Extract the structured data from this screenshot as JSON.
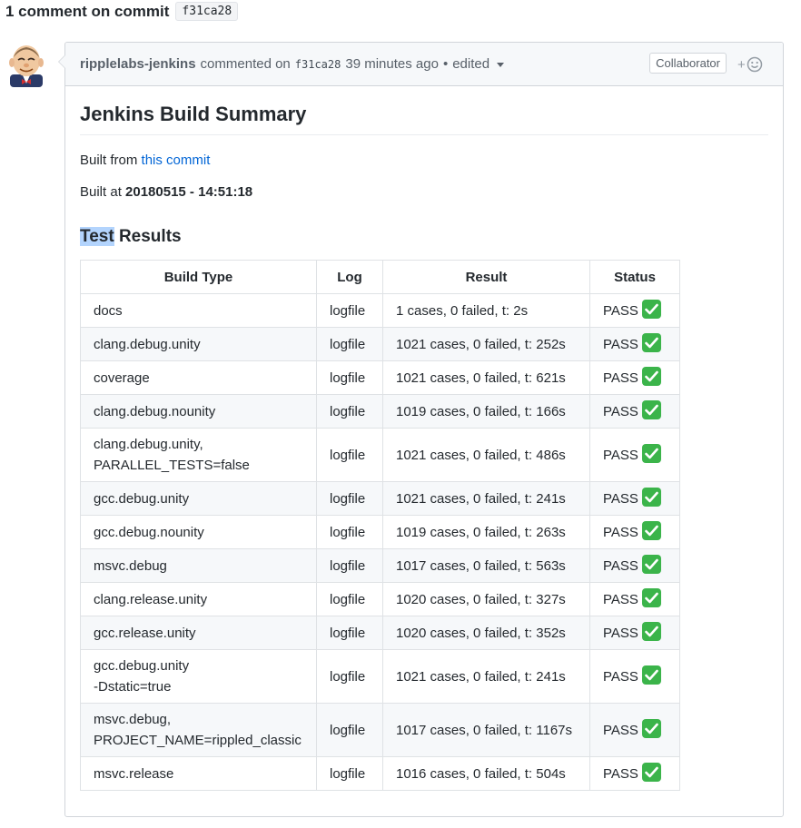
{
  "heading": {
    "text": "1 comment on commit",
    "sha": "f31ca28"
  },
  "comment": {
    "author": "ripplelabs-jenkins",
    "commented_on": "commented on",
    "sha": "f31ca28",
    "time": "39 minutes ago",
    "bullet": "•",
    "edited": "edited",
    "badge": "Collaborator",
    "reaction_plus": "+"
  },
  "body": {
    "title": "Jenkins Build Summary",
    "built_from_prefix": "Built from",
    "built_from_link": "this commit",
    "built_at_prefix": "Built at",
    "built_at_value": "20180515 - 14:51:18",
    "results_title_highlight": "Test",
    "results_title_rest": "Results"
  },
  "table": {
    "headers": [
      "Build Type",
      "Log",
      "Result",
      "Status"
    ],
    "rows": [
      {
        "type": "docs",
        "type2": "",
        "log": "logfile",
        "result": "1 cases, 0 failed, t: 2s",
        "status": "PASS"
      },
      {
        "type": "clang.debug.unity",
        "type2": "",
        "log": "logfile",
        "result": "1021 cases, 0 failed, t: 252s",
        "status": "PASS"
      },
      {
        "type": "coverage",
        "type2": "",
        "log": "logfile",
        "result": "1021 cases, 0 failed, t: 621s",
        "status": "PASS"
      },
      {
        "type": "clang.debug.nounity",
        "type2": "",
        "log": "logfile",
        "result": "1019 cases, 0 failed, t: 166s",
        "status": "PASS"
      },
      {
        "type": "clang.debug.unity,",
        "type2": "PARALLEL_TESTS=false",
        "log": "logfile",
        "result": "1021 cases, 0 failed, t: 486s",
        "status": "PASS"
      },
      {
        "type": "gcc.debug.unity",
        "type2": "",
        "log": "logfile",
        "result": "1021 cases, 0 failed, t: 241s",
        "status": "PASS"
      },
      {
        "type": "gcc.debug.nounity",
        "type2": "",
        "log": "logfile",
        "result": "1019 cases, 0 failed, t: 263s",
        "status": "PASS"
      },
      {
        "type": "msvc.debug",
        "type2": "",
        "log": "logfile",
        "result": "1017 cases, 0 failed, t: 563s",
        "status": "PASS"
      },
      {
        "type": "clang.release.unity",
        "type2": "",
        "log": "logfile",
        "result": "1020 cases, 0 failed, t: 327s",
        "status": "PASS"
      },
      {
        "type": "gcc.release.unity",
        "type2": "",
        "log": "logfile",
        "result": "1020 cases, 0 failed, t: 352s",
        "status": "PASS"
      },
      {
        "type": "gcc.debug.unity",
        "type2": "-Dstatic=true",
        "log": "logfile",
        "result": "1021 cases, 0 failed, t: 241s",
        "status": "PASS"
      },
      {
        "type": "msvc.debug,",
        "type2": "PROJECT_NAME=rippled_classic",
        "log": "logfile",
        "result": "1017 cases, 0 failed, t: 1167s",
        "status": "PASS"
      },
      {
        "type": "msvc.release",
        "type2": "",
        "log": "logfile",
        "result": "1016 cases, 0 failed, t: 504s",
        "status": "PASS"
      }
    ]
  },
  "colors": {
    "link": "#0366d6",
    "pass_check_bg": "#3bb44a",
    "header_bg": "#f6f8fa",
    "border": "#d1d5da",
    "highlight": "#b3d4fd"
  },
  "icons": {
    "avatar": "jenkins-avatar-icon",
    "caret": "caret-down-icon",
    "reaction": "smiley-icon",
    "status": "check-mark-icon"
  }
}
